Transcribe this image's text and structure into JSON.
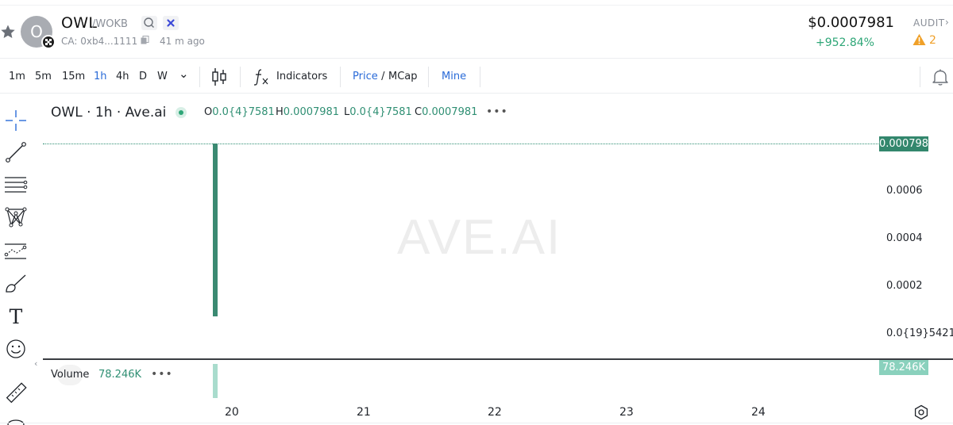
{
  "header": {
    "token_name": "OWL",
    "token_pair": "/WOKB",
    "avatar_letter": "O",
    "ca_label": "CA: 0xb4...1111",
    "age": "41 m ago",
    "price": "$0.0007981",
    "change": "+952.84%",
    "audit_label": "AUDIT",
    "audit_chevron": "›",
    "warning_count": "2",
    "icons": [
      "star-icon",
      "search-icon",
      "okx-chain-icon",
      "copy-icon",
      "warning-icon"
    ]
  },
  "toolbar": {
    "timeframes": [
      "1m",
      "5m",
      "15m",
      "1h",
      "4h",
      "D",
      "W"
    ],
    "active_timeframe": "1h",
    "more_chevron": "⌄",
    "indicators_label": "Indicators",
    "price_label": "Price",
    "price_sep": " / ",
    "mcap_label": "MCap",
    "mine_label": "Mine",
    "icons": [
      "candlestick-icon",
      "fx-icon",
      "bell-icon"
    ]
  },
  "tools": [
    "crosshair-icon",
    "trend-line-icon",
    "fib-lines-icon",
    "pattern-icon",
    "projection-icon",
    "brush-icon",
    "text-icon",
    "emoji-icon",
    "ruler-icon"
  ],
  "text_tool_glyph": "T",
  "chart": {
    "legend_title": "OWL · 1h · Ave.ai",
    "ohlc": {
      "o_label": "O",
      "o_value": "0.0{4}7581",
      "h_label": "H",
      "h_value": "0.0007981",
      "l_label": "L",
      "l_value": "0.0{4}7581",
      "c_label": "C",
      "c_value": "0.0007981"
    },
    "more_dots": "•••",
    "watermark": "AVE.AI",
    "last_price_tag": "0.0007981",
    "y_ticks": [
      "0.0006",
      "0.0004",
      "0.0002",
      "0.0{19}5421"
    ],
    "collapse_arrow": "‹",
    "volume_label": "Volume",
    "volume_value": "78.246K",
    "volume_tag": "78.246K",
    "x_ticks": [
      "20",
      "21",
      "22",
      "23",
      "24"
    ],
    "up_color": "#3b8a72",
    "volume_color": "#a9dccd"
  },
  "chart_data": {
    "type": "candlestick",
    "timeframe": "1h",
    "candles": [
      {
        "x": "20",
        "open": 7.581e-05,
        "high": 0.0007981,
        "low": 7.581e-05,
        "close": 0.0007981,
        "volume": 78246
      }
    ],
    "x_tick_labels": [
      "20",
      "21",
      "22",
      "23",
      "24"
    ],
    "y_tick_labels": [
      "0.0006",
      "0.0004",
      "0.0002",
      "0.0{19}5421"
    ],
    "last_price": 0.0007981
  }
}
